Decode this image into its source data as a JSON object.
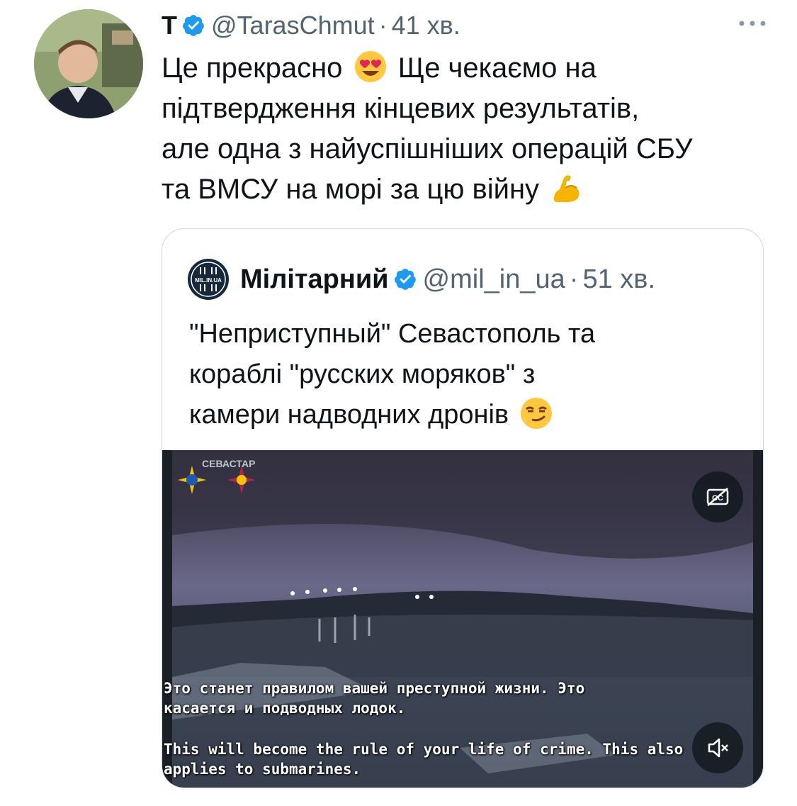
{
  "tweet": {
    "author_name": "T",
    "handle": "@TarasChmut",
    "separator": "·",
    "time": "41 хв.",
    "lines": [
      "Це прекрасно",
      "Ще чекаємо на",
      "підтвердження кінцевих результатів,",
      "але одна з найуспішніших операцій СБУ",
      "та ВМСУ на морі за цю війну"
    ],
    "emojis": [
      "heart-eyes-emoji",
      "flexed-biceps-emoji"
    ]
  },
  "quote": {
    "avatar_text": "MIL.IN.UA",
    "author_name": "Мілітарний",
    "handle": "@mil_in_ua",
    "separator": "·",
    "time": "51 хв.",
    "lines": [
      "\"Неприступный\" Севастополь та",
      "кораблі \"русских моряков\" з",
      "камери надводних дронів"
    ],
    "emoji": "smirking-face-emoji"
  },
  "video": {
    "overlay_logo_text": "СЕВАСТАР",
    "subtitle_ru_1": "Это станет правилом вашей преступной жизни. Это",
    "subtitle_ru_2": "касается и подводных лодок.",
    "subtitle_en_1": "This will become the rule of your life of crime. This also",
    "subtitle_en_2": "applies to submarines.",
    "icons": [
      "captions-off-icon",
      "volume-muted-icon"
    ]
  },
  "colors": {
    "verified_blue": "#1d9bf0",
    "secondary_text": "#536471",
    "border": "#cfd9de"
  }
}
